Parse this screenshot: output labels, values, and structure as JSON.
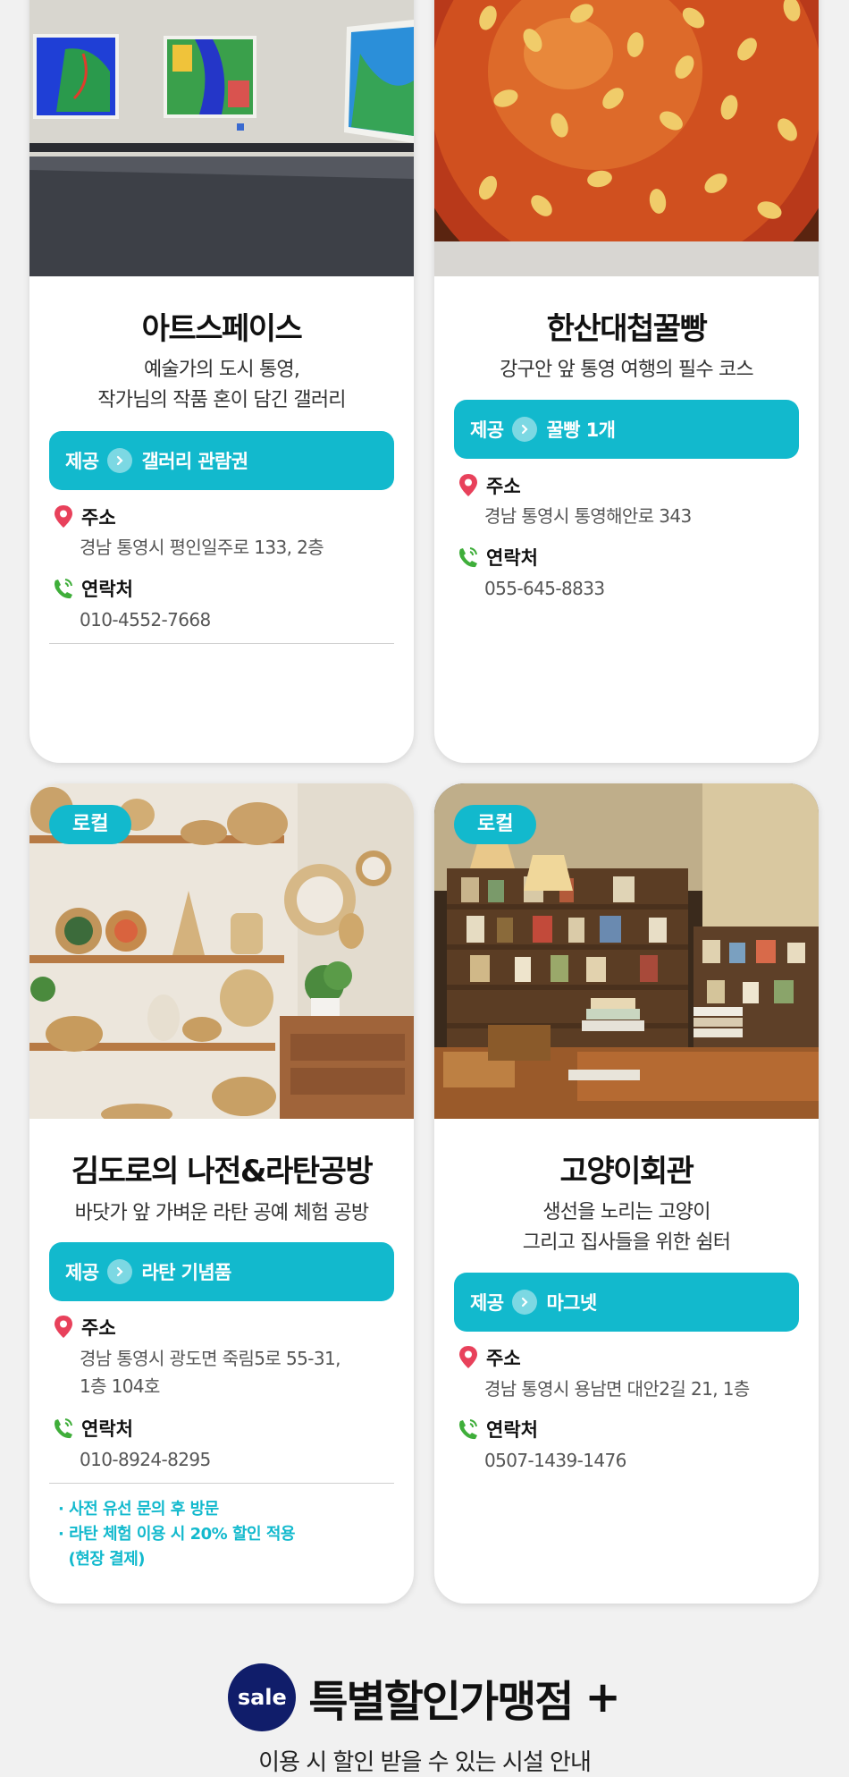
{
  "stores": [
    {
      "name": "아트스페이스",
      "desc_lines": [
        "예술가의 도시 통영,",
        "작가님의 작품 혼이 담긴 갤러리"
      ],
      "provide_label": "제공",
      "provide_value": "갤러리 관람권",
      "address_label": "주소",
      "address_lines": [
        "경남 통영시 평인일주로 133, 2층"
      ],
      "contact_label": "연락처",
      "contact": "010-4552-7668"
    },
    {
      "name": "한산대첩꿀빵",
      "desc_lines": [
        "강구안 앞 통영 여행의 필수 코스"
      ],
      "provide_label": "제공",
      "provide_value": "꿀빵 1개",
      "address_label": "주소",
      "address_lines": [
        "경남 통영시 통영해안로 343"
      ],
      "contact_label": "연락처",
      "contact": "055-645-8833"
    },
    {
      "tag": "로컬",
      "name": "김도로의 나전&라탄공방",
      "desc_lines": [
        "바닷가 앞 가벼운 라탄 공예 체험 공방"
      ],
      "provide_label": "제공",
      "provide_value": "라탄 기념품",
      "address_label": "주소",
      "address_lines": [
        "경남 통영시 광도면 죽림5로 55-31,",
        "1층 104호"
      ],
      "contact_label": "연락처",
      "contact": "010-8924-8295",
      "notes": [
        "· 사전 유선 문의 후 방문",
        "· 라탄 체험 이용 시 20% 할인 적용",
        "  (현장 결제)"
      ]
    },
    {
      "tag": "로컬",
      "name": "고양이회관",
      "desc_lines": [
        "생선을 노리는 고양이",
        "그리고 집사들을 위한 쉼터"
      ],
      "provide_label": "제공",
      "provide_value": "마그넷",
      "address_label": "주소",
      "address_lines": [
        "경남 통영시 용남면 대안2길 21, 1층"
      ],
      "contact_label": "연락처",
      "contact": "0507-1439-1476"
    }
  ],
  "footer": {
    "badge": "sale",
    "heading": "특별할인가맹점",
    "plus": "+",
    "subtitle": "이용 시 할인 받을 수 있는 시설 안내"
  },
  "colors": {
    "accent": "#12b9cd",
    "badge_navy": "#101d6a",
    "pin_red": "#e8415b",
    "phone_green": "#3fae3a"
  },
  "icons": {
    "address": "map-pin-icon",
    "contact": "phone-icon",
    "provide_arrow": "chevron-right-icon"
  }
}
